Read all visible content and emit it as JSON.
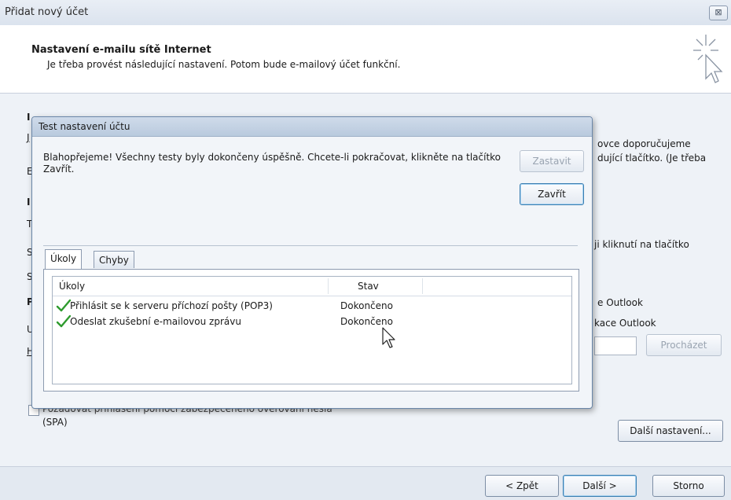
{
  "outer": {
    "title": "Přidat nový účet",
    "close_glyph": "⊠",
    "header_title": "Nastavení e-mailu sítě Internet",
    "header_subtitle": "Je třeba provést následující nastavení. Potom bude e-mailový účet funkční.",
    "background_fragments": {
      "left_i": "I",
      "left_j": "J",
      "left_e": "E",
      "left_i2": "I",
      "left_t": "T",
      "left_s": "S",
      "left_s2": "S",
      "left_p": "P",
      "left_u": "U",
      "left_h": "H",
      "right_line1": "ovce doporučujeme",
      "right_line2": "dující tlačítko. (Je třeba",
      "right_line3": "ji kliknutí na tlačítko",
      "right_line4": "e Outlook",
      "right_line5": "kace Outlook"
    },
    "browse_button": "Procházet",
    "spa_label_line1": "Požadovat přihlášení pomocí zabezpečeného ověřování hesla",
    "spa_label_line2": "(SPA)",
    "more_settings_button": "Další nastavení...",
    "footer": {
      "back": "< Zpět",
      "next": "Další >",
      "cancel": "Storno"
    }
  },
  "test_dialog": {
    "title": "Test nastavení účtu",
    "message": "Blahopřejeme! Všechny testy byly dokončeny úspěšně. Chcete-li pokračovat, klikněte na tlačítko Zavřít.",
    "stop_button": "Zastavit",
    "close_button": "Zavřít",
    "tabs": [
      {
        "label": "Úkoly",
        "active": true
      },
      {
        "label": "Chyby",
        "active": false
      }
    ],
    "columns": {
      "tasks": "Úkoly",
      "status": "Stav"
    },
    "rows": [
      {
        "task": "Přihlásit se k serveru příchozí pošty (POP3)",
        "status": "Dokončeno",
        "icon": "check-icon"
      },
      {
        "task": "Odeslat zkušební e-mailovou zprávu",
        "status": "Dokončeno",
        "icon": "check-icon"
      }
    ]
  },
  "colors": {
    "check_green": "#2e9b2e",
    "accent_border": "#3c7fb1"
  }
}
